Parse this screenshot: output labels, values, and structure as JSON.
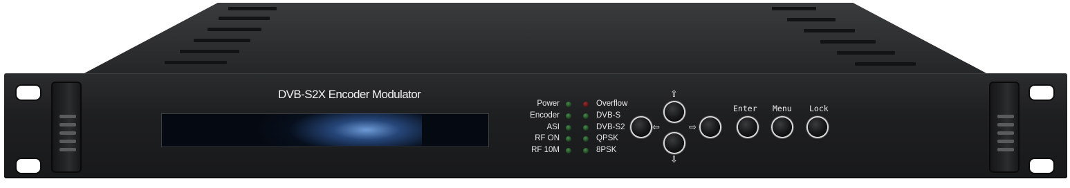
{
  "device": {
    "title": "DVB-S2X Encoder Modulator",
    "left_indicators": [
      {
        "label": "Power",
        "state": "green"
      },
      {
        "label": "Encoder",
        "state": "green"
      },
      {
        "label": "ASI",
        "state": "green"
      },
      {
        "label": "RF ON",
        "state": "green"
      },
      {
        "label": "RF 10M",
        "state": "green"
      }
    ],
    "right_indicators": [
      {
        "label": "Overflow",
        "state": "red"
      },
      {
        "label": "DVB-S",
        "state": "green"
      },
      {
        "label": "DVB-S2",
        "state": "green"
      },
      {
        "label": "QPSK",
        "state": "green"
      },
      {
        "label": "8PSK",
        "state": "green"
      }
    ],
    "nav_arrows": {
      "up": "⇧",
      "down": "⇩",
      "left": "⇦",
      "right": "⇨"
    },
    "buttons": {
      "enter": "Enter",
      "menu": "Menu",
      "lock": "Lock"
    },
    "colors": {
      "panel": "#1e1f21",
      "text": "#e8e8e8",
      "led_green": "#2f6a33",
      "led_red": "#7a2020"
    }
  }
}
